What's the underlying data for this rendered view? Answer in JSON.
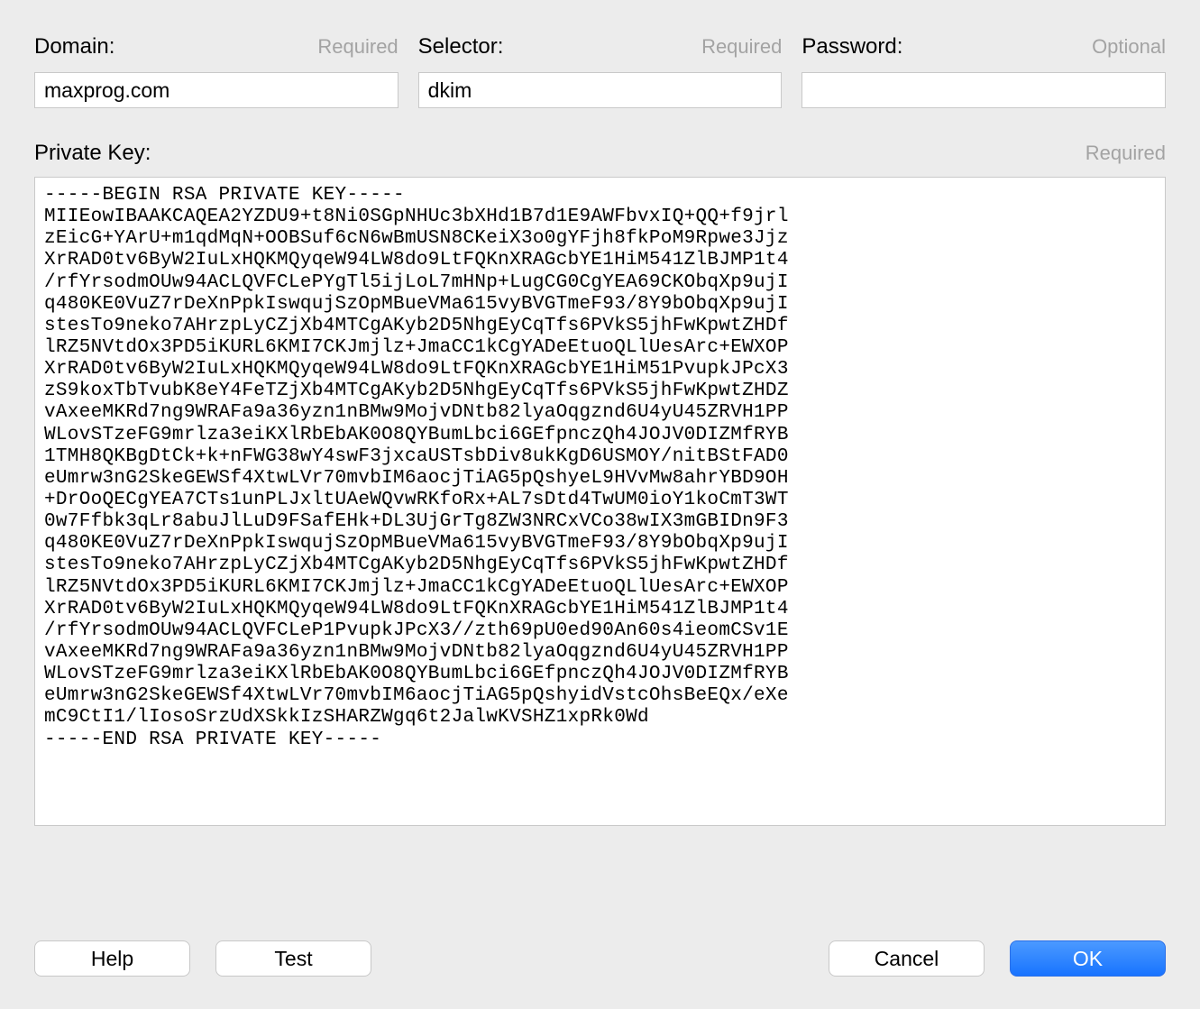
{
  "fields": {
    "domain": {
      "label": "Domain:",
      "hint": "Required",
      "value": "maxprog.com"
    },
    "selector": {
      "label": "Selector:",
      "hint": "Required",
      "value": "dkim"
    },
    "password": {
      "label": "Password:",
      "hint": "Optional",
      "value": ""
    },
    "private_key": {
      "label": "Private Key:",
      "hint": "Required",
      "value": "-----BEGIN RSA PRIVATE KEY-----\nMIIEowIBAAKCAQEA2YZDU9+t8Ni0SGpNHUc3bXHd1B7d1E9AWFbvxIQ+QQ+f9jrl\nzEicG+YArU+m1qdMqN+OOBSuf6cN6wBmUSN8CKeiX3o0gYFjh8fkPoM9Rpwe3Jjz\nXrRAD0tv6ByW2IuLxHQKMQyqeW94LW8do9LtFQKnXRAGcbYE1HiM541ZlBJMP1t4\n/rfYrsodmOUw94ACLQVFCLePYgTl5ijLoL7mHNp+LugCG0CgYEA69CKObqXp9ujI\nq480KE0VuZ7rDeXnPpkIswqujSzOpMBueVMa615vyBVGTmeF93/8Y9bObqXp9ujI\nstesTo9neko7AHrzpLyCZjXb4MTCgAKyb2D5NhgEyCqTfs6PVkS5jhFwKpwtZHDf\nlRZ5NVtdOx3PD5iKURL6KMI7CKJmjlz+JmaCC1kCgYADeEtuoQLlUesArc+EWXOP\nXrRAD0tv6ByW2IuLxHQKMQyqeW94LW8do9LtFQKnXRAGcbYE1HiM51PvupkJPcX3\nzS9koxTbTvubK8eY4FeTZjXb4MTCgAKyb2D5NhgEyCqTfs6PVkS5jhFwKpwtZHDZ\nvAxeeMKRd7ng9WRAFa9a36yzn1nBMw9MojvDNtb82lyaOqgznd6U4yU45ZRVH1PP\nWLovSTzeFG9mrlza3eiKXlRbEbAK0O8QYBumLbci6GEfpnczQh4JOJV0DIZMfRYB\n1TMH8QKBgDtCk+k+nFWG38wY4swF3jxcaUSTsbDiv8ukKgD6USMOY/nitBStFAD0\neUmrw3nG2SkeGEWSf4XtwLVr70mvbIM6aocjTiAG5pQshyeL9HVvMw8ahrYBD9OH\n+DrOoQECgYEA7CTs1unPLJxltUAeWQvwRKfoRx+AL7sDtd4TwUM0ioY1koCmT3WT\n0w7Ffbk3qLr8abuJlLuD9FSafEHk+DL3UjGrTg8ZW3NRCxVCo38wIX3mGBIDn9F3\nq480KE0VuZ7rDeXnPpkIswqujSzOpMBueVMa615vyBVGTmeF93/8Y9bObqXp9ujI\nstesTo9neko7AHrzpLyCZjXb4MTCgAKyb2D5NhgEyCqTfs6PVkS5jhFwKpwtZHDf\nlRZ5NVtdOx3PD5iKURL6KMI7CKJmjlz+JmaCC1kCgYADeEtuoQLlUesArc+EWXOP\nXrRAD0tv6ByW2IuLxHQKMQyqeW94LW8do9LtFQKnXRAGcbYE1HiM541ZlBJMP1t4\n/rfYrsodmOUw94ACLQVFCLeP1PvupkJPcX3//zth69pU0ed90An60s4ieomCSv1E\nvAxeeMKRd7ng9WRAFa9a36yzn1nBMw9MojvDNtb82lyaOqgznd6U4yU45ZRVH1PP\nWLovSTzeFG9mrlza3eiKXlRbEbAK0O8QYBumLbci6GEfpnczQh4JOJV0DIZMfRYB\neUmrw3nG2SkeGEWSf4XtwLVr70mvbIM6aocjTiAG5pQshyidVstcOhsBeEQx/eXe\nmC9CtI1/lIosoSrzUdXSkkIzSHARZWgq6t2JalwKVSHZ1xpRk0Wd\n-----END RSA PRIVATE KEY-----"
    }
  },
  "buttons": {
    "help": "Help",
    "test": "Test",
    "cancel": "Cancel",
    "ok": "OK"
  }
}
